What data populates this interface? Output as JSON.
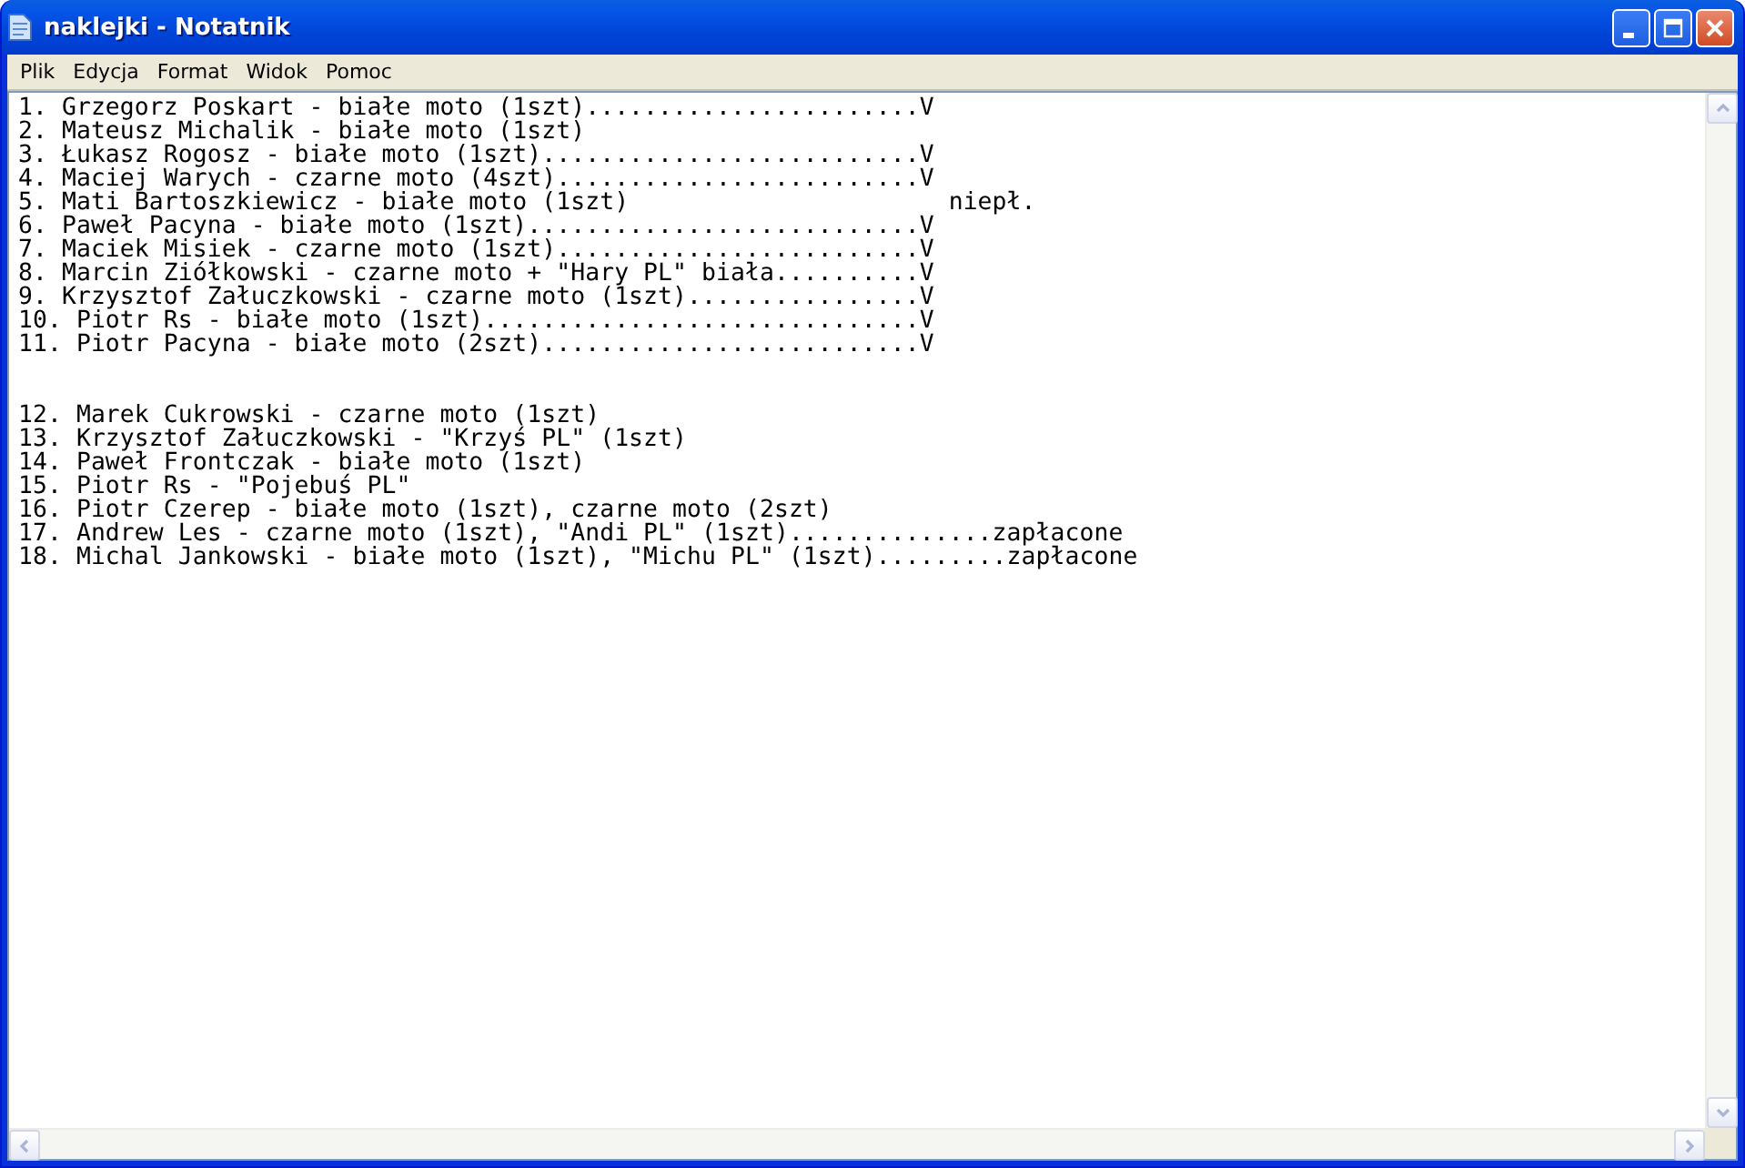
{
  "window": {
    "title": "naklejki - Notatnik"
  },
  "menu": [
    "Plik",
    "Edycja",
    "Format",
    "Widok",
    "Pomoc"
  ],
  "text_blocks": [
    [
      "1. Grzegorz Poskart - białe moto (1szt).......................V",
      "2. Mateusz Michalik - białe moto (1szt)",
      "3. Łukasz Rogosz - białe moto (1szt)..........................V",
      "4. Maciej Warych - czarne moto (4szt).........................V",
      "5. Mati Bartoszkiewicz - białe moto (1szt)                      niepł.",
      "6. Paweł Pacyna - białe moto (1szt)...........................V",
      "7. Maciek Misiek - czarne moto (1szt).........................V",
      "8. Marcin Ziółkowski - czarne moto + \"Hary PL\" biała..........V",
      "9. Krzysztof Załuczkowski - czarne moto (1szt)................V",
      "10. Piotr Rs - białe moto (1szt)..............................V",
      "11. Piotr Pacyna - białe moto (2szt)..........................V"
    ],
    [
      "12. Marek Cukrowski - czarne moto (1szt)",
      "13. Krzysztof Załuczkowski - \"Krzyś PL\" (1szt)",
      "14. Paweł Frontczak - białe moto (1szt)",
      "15. Piotr Rs - \"Pojebuś PL\"",
      "16. Piotr Czerep - białe moto (1szt), czarne moto (2szt)",
      "17. Andrew Les - czarne moto (1szt), \"Andi PL\" (1szt)..............zapłacone",
      "18. Michal Jankowski - białe moto (1szt), \"Michu PL\" (1szt).........zapłacone"
    ]
  ]
}
